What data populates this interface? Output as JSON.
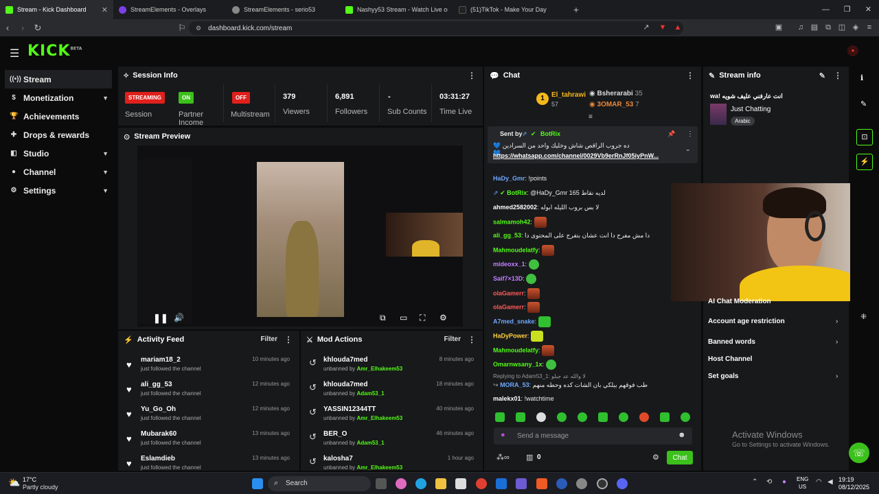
{
  "browser": {
    "tabs": [
      {
        "title": "Stream - Kick Dashboard",
        "active": true,
        "color": "#53fc18"
      },
      {
        "title": "StreamElements - Overlays",
        "active": false,
        "color": "#7b3fe4"
      },
      {
        "title": "StreamElements - serio53",
        "active": false,
        "color": "#888888"
      },
      {
        "title": "Nashyy53 Stream - Watch Live on Kick",
        "active": false,
        "color": "#53fc18"
      },
      {
        "title": "(51)TikTok - Make Your Day",
        "active": false,
        "color": "#222222"
      }
    ],
    "url": "dashboard.kick.com/stream"
  },
  "logo": {
    "text": "KICK",
    "sup": "BETA"
  },
  "sidebar": {
    "items": [
      {
        "label": "Stream",
        "icon": "broadcast-icon",
        "active": true,
        "chevron": false
      },
      {
        "label": "Monetization",
        "icon": "dollar-icon",
        "active": false,
        "chevron": true
      },
      {
        "label": "Achievements",
        "icon": "trophy-icon",
        "active": false,
        "chevron": false
      },
      {
        "label": "Drops & rewards",
        "icon": "gift-icon",
        "active": false,
        "chevron": false
      },
      {
        "label": "Studio",
        "icon": "studio-icon",
        "active": false,
        "chevron": true
      },
      {
        "label": "Channel",
        "icon": "user-icon",
        "active": false,
        "chevron": true
      },
      {
        "label": "Settings",
        "icon": "gear-icon",
        "active": false,
        "chevron": true
      }
    ]
  },
  "session": {
    "title": "Session Info",
    "streaming_badge": "STREAMING",
    "session_label": "Session",
    "on_badge": "ON",
    "partner_label": "Partner Income",
    "off_badge": "OFF",
    "multistream_label": "Multistream",
    "viewers": "379",
    "viewers_label": "Viewers",
    "followers": "6,891",
    "followers_label": "Followers",
    "subs": "-",
    "subs_label": "Sub Counts",
    "time": "03:31:27",
    "time_label": "Time Live"
  },
  "preview": {
    "title": "Stream Preview"
  },
  "activity": {
    "title": "Activity Feed",
    "filter": "Filter",
    "items": [
      {
        "name": "mariam18_2",
        "action": "just followed the channel",
        "time": "10 minutes ago"
      },
      {
        "name": "ali_gg_53",
        "action": "just followed the channel",
        "time": "12 minutes ago"
      },
      {
        "name": "Yu_Go_Oh",
        "action": "just followed the channel",
        "time": "12 minutes ago"
      },
      {
        "name": "Mubarak60",
        "action": "just followed the channel",
        "time": "13 minutes ago"
      },
      {
        "name": "Eslamdieb",
        "action": "just followed the channel",
        "time": "13 minutes ago"
      }
    ]
  },
  "mod": {
    "title": "Mod Actions",
    "filter": "Filter",
    "items": [
      {
        "name": "khlouda7med",
        "action": "unbanned by",
        "by": "Amr_Elhakeem53",
        "time": "8 minutes ago"
      },
      {
        "name": "khlouda7med",
        "action": "unbanned by",
        "by": "Adam53_1",
        "time": "18 minutes ago"
      },
      {
        "name": "YASSIN12344TT",
        "action": "unbanned by",
        "by": "Amr_Elhakeem53",
        "time": "40 minutes ago"
      },
      {
        "name": "BER_O",
        "action": "unbanned by",
        "by": "Adam53_1",
        "time": "46 minutes ago"
      },
      {
        "name": "kalosha7",
        "action": "unbanned by",
        "by": "Amr_Elhakeem53",
        "time": "1 hour ago"
      }
    ]
  },
  "chat": {
    "title": "Chat",
    "top1_name": "El_tahrawi",
    "top1_count": "57",
    "top2_name": "Bsherarabi",
    "top2_count": "35",
    "top3_name": "3OMAR_53",
    "top3_count": "7",
    "pinned_sender": "BotRix",
    "pinned_prefix": "Sent by",
    "pinned_text": "ده جروب الراقص شاش وخليك واحد من السرادين 💙💙",
    "pinned_link": "https://whatsapp.com/channel/0029Vb9erRnJf05iyPnW...",
    "messages": [
      {
        "user": "HaDy_Gmr",
        "color": "#6fa8ff",
        "text": "!points"
      },
      {
        "user": "BotRix",
        "color": "#53fc18",
        "text": "@HaDy_Gmr 165 لديه نقاط"
      },
      {
        "user": "ahmed2582002",
        "color": "#ffffff",
        "text": "لا بس بروب الليله ابوله"
      },
      {
        "user": "salmamoh42",
        "color": "#53fc18",
        "text": ""
      },
      {
        "user": "ali_gg_53",
        "color": "#53fc18",
        "text": "دا مش مفرح دا انت عشان بتفرج على المحتوى دا"
      },
      {
        "user": "Mahmoudelatfy",
        "color": "#53fc18",
        "text": ""
      },
      {
        "user": "mideoxx_1",
        "color": "#c080ff",
        "text": ""
      },
      {
        "user": "Saif7×13D",
        "color": "#c080ff",
        "text": ""
      },
      {
        "user": "olaGamerr",
        "color": "#ff5a5a",
        "text": ""
      },
      {
        "user": "olaGamerr",
        "color": "#ff5a5a",
        "text": ""
      },
      {
        "user": "A7med_snake",
        "color": "#6fa8ff",
        "text": ""
      },
      {
        "user": "HaDyPower",
        "color": "#ffd23f",
        "text": ""
      },
      {
        "user": "Mahmoudelatfy",
        "color": "#53fc18",
        "text": ""
      },
      {
        "user": "Omarnwsany_1x",
        "color": "#53fc18",
        "text": ""
      },
      {
        "user": "MORA_53",
        "color": "#6fa8ff",
        "text": "طب فوقهم بيلكي بان الشات كده وحطه منهم"
      },
      {
        "user": "malekx01",
        "color": "#ffffff",
        "text": "!watchtime"
      }
    ],
    "replying": "Replying to Adam53_1: لا والله عد جيلو",
    "placeholder": "Send a message",
    "count": "0",
    "send": "Chat"
  },
  "streaminfo": {
    "title": "Stream info",
    "stream_title": "wa! انت عارفني عليف شويه",
    "category": "Just Chatting",
    "tag": "Arabic"
  },
  "settings_list": [
    {
      "label": "AI Chat Moderation",
      "chevron": false
    },
    {
      "label": "Account age restriction",
      "chevron": true
    },
    {
      "label": "Banned words",
      "chevron": true
    },
    {
      "label": "Host Channel",
      "chevron": false
    },
    {
      "label": "Set goals",
      "chevron": true
    }
  ],
  "watermark": {
    "line1": "Activate Windows",
    "line2": "Go to Settings to activate Windows."
  },
  "taskbar": {
    "weather_temp": "17°C",
    "weather_desc": "Partly cloudy",
    "search": "Search",
    "lang1": "ENG",
    "lang2": "US",
    "time": "19:19",
    "date": "08/12/2025"
  }
}
